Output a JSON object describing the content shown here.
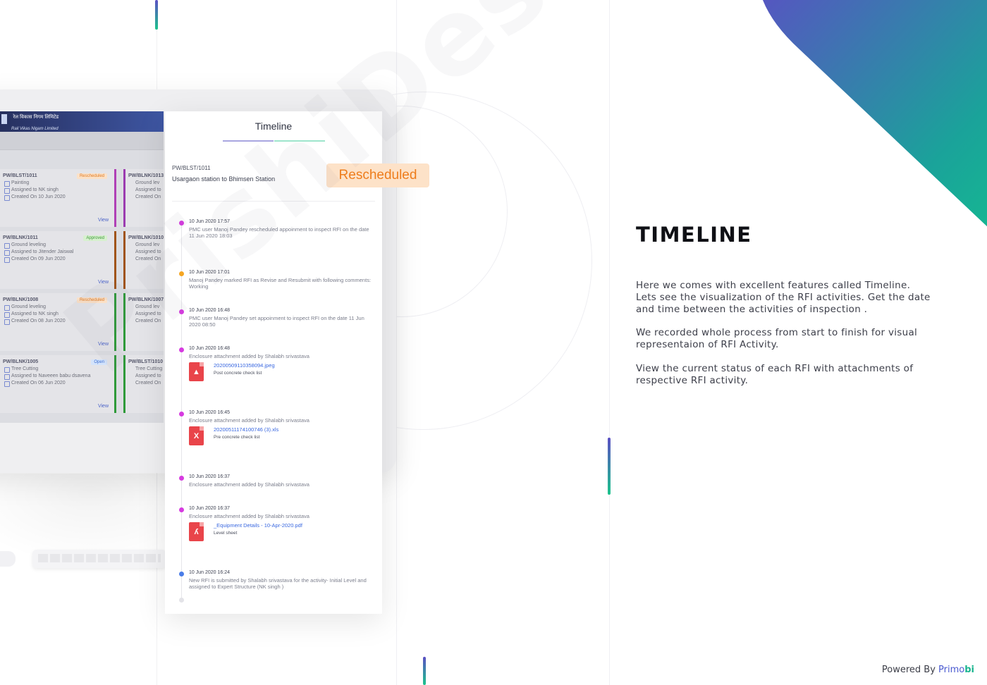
{
  "monitor_screen": {
    "org_line1": "रेल विकास निगम लिमिटेड",
    "org_line2": "Rail Vikas Nigam Limited",
    "cards": [
      {
        "id": "PW/BLST/1011",
        "badge": "Rescheduled",
        "activity": "Painting",
        "assigned": "Assigned to NK singh",
        "created": "Created On 10 Jun 2020",
        "view": "View"
      },
      {
        "id": "PW/BLNK/1011",
        "badge": "Approved",
        "activity": "Ground leveling",
        "assigned": "Assigned to Jitender Jaiswal",
        "created": "Created On 09 Jun 2020",
        "view": "View"
      },
      {
        "id": "PW/BLNK/1008",
        "badge": "Rescheduled",
        "activity": "Ground leveling",
        "assigned": "Assigned to NK singh",
        "created": "Created On 08 Jun 2020",
        "view": "View"
      },
      {
        "id": "PW/BLNK/1005",
        "badge": "Open",
        "activity": "Tree Cutting",
        "assigned": "Assigned to Naveeen babu dsavena",
        "created": "Created On 06 Jun 2020",
        "view": "View"
      }
    ],
    "side_cards": [
      {
        "id": "PW/BLNK/1013",
        "activity": "Ground lev",
        "assigned": "Assigned to",
        "created": "Created On"
      },
      {
        "id": "PW/BLNK/1010",
        "activity": "Ground lev",
        "assigned": "Assigned to",
        "created": "Created On"
      },
      {
        "id": "PW/BLNK/1007",
        "activity": "Ground lev",
        "assigned": "Assigned to",
        "created": "Created On"
      },
      {
        "id": "PW/BLST/1010",
        "activity": "Tree Cutting",
        "assigned": "Assigned to",
        "created": "Created On"
      }
    ]
  },
  "timeline_panel": {
    "title": "Timeline",
    "rfi_id": "PW/BLST/1011",
    "location": "Usargaon station to Bhimsen Station",
    "status": "Rescheduled",
    "events": [
      {
        "time": "10 Jun 2020 17:57",
        "text": "PMC user Manoj Pandey rescheduled appoinment to inspect RFI on the date 11 Jun 2020 18:03"
      },
      {
        "time": "10 Jun 2020 17:01",
        "text": "Manoj Pandey marked RFI as Revise and Resubmit with following comments: Working"
      },
      {
        "time": "10 Jun 2020 16:48",
        "text": "PMC user Manoj Pandey set appoinment to inspect RFI on the date 11 Jun 2020 08:50"
      },
      {
        "time": "10 Jun 2020 16:48",
        "text": "Enclosure attachment added by Shalabh srivastava",
        "file": "20200509110358094.jpeg",
        "file_desc": "Post concrete check list"
      },
      {
        "time": "10 Jun 2020 16:45",
        "text": "Enclosure attachment added by Shalabh srivastava",
        "file": "20200511174100746 (3).xls",
        "file_desc": "Pre concrete check list"
      },
      {
        "time": "10 Jun 2020 16:37",
        "text": "Enclosure attachment added by Shalabh srivastava"
      },
      {
        "time": "10 Jun 2020 16:37",
        "text": "Enclosure attachment added by Shalabh srivastava",
        "file": "_Equipment Details - 10-Apr-2020.pdf",
        "file_desc": "Level sheet"
      },
      {
        "time": "10 Jun 2020 16:24",
        "text": "New RFI is submitted by Shalabh srivastava for the activity- Initial Level and assigned to Expert Structure (NK singh )"
      }
    ]
  },
  "watermark": "PrishiDesignel",
  "content": {
    "heading": "TIMELINE",
    "para1": "Here we comes with excellent features called Timeline. Lets see the visualization of the RFI activities. Get the date and time between the activities of inspection .",
    "para2": "We recorded whole process from start to finish for visual representaion of RFI Activity.",
    "para3": "View the current status of each RFI with attachments of respective RFI activity."
  },
  "footer": {
    "powered_by": "Powered By",
    "brand": "Primo",
    "brand_suffix": "bi"
  },
  "colors": {
    "accent_purple": "#5b4fc4",
    "accent_green": "#1cc38c",
    "status_orange": "#ee7d1c",
    "dot_magenta": "#d63be0",
    "dot_orange": "#f5a623",
    "dot_blue": "#4a7de8",
    "file_link": "#3867e0"
  }
}
